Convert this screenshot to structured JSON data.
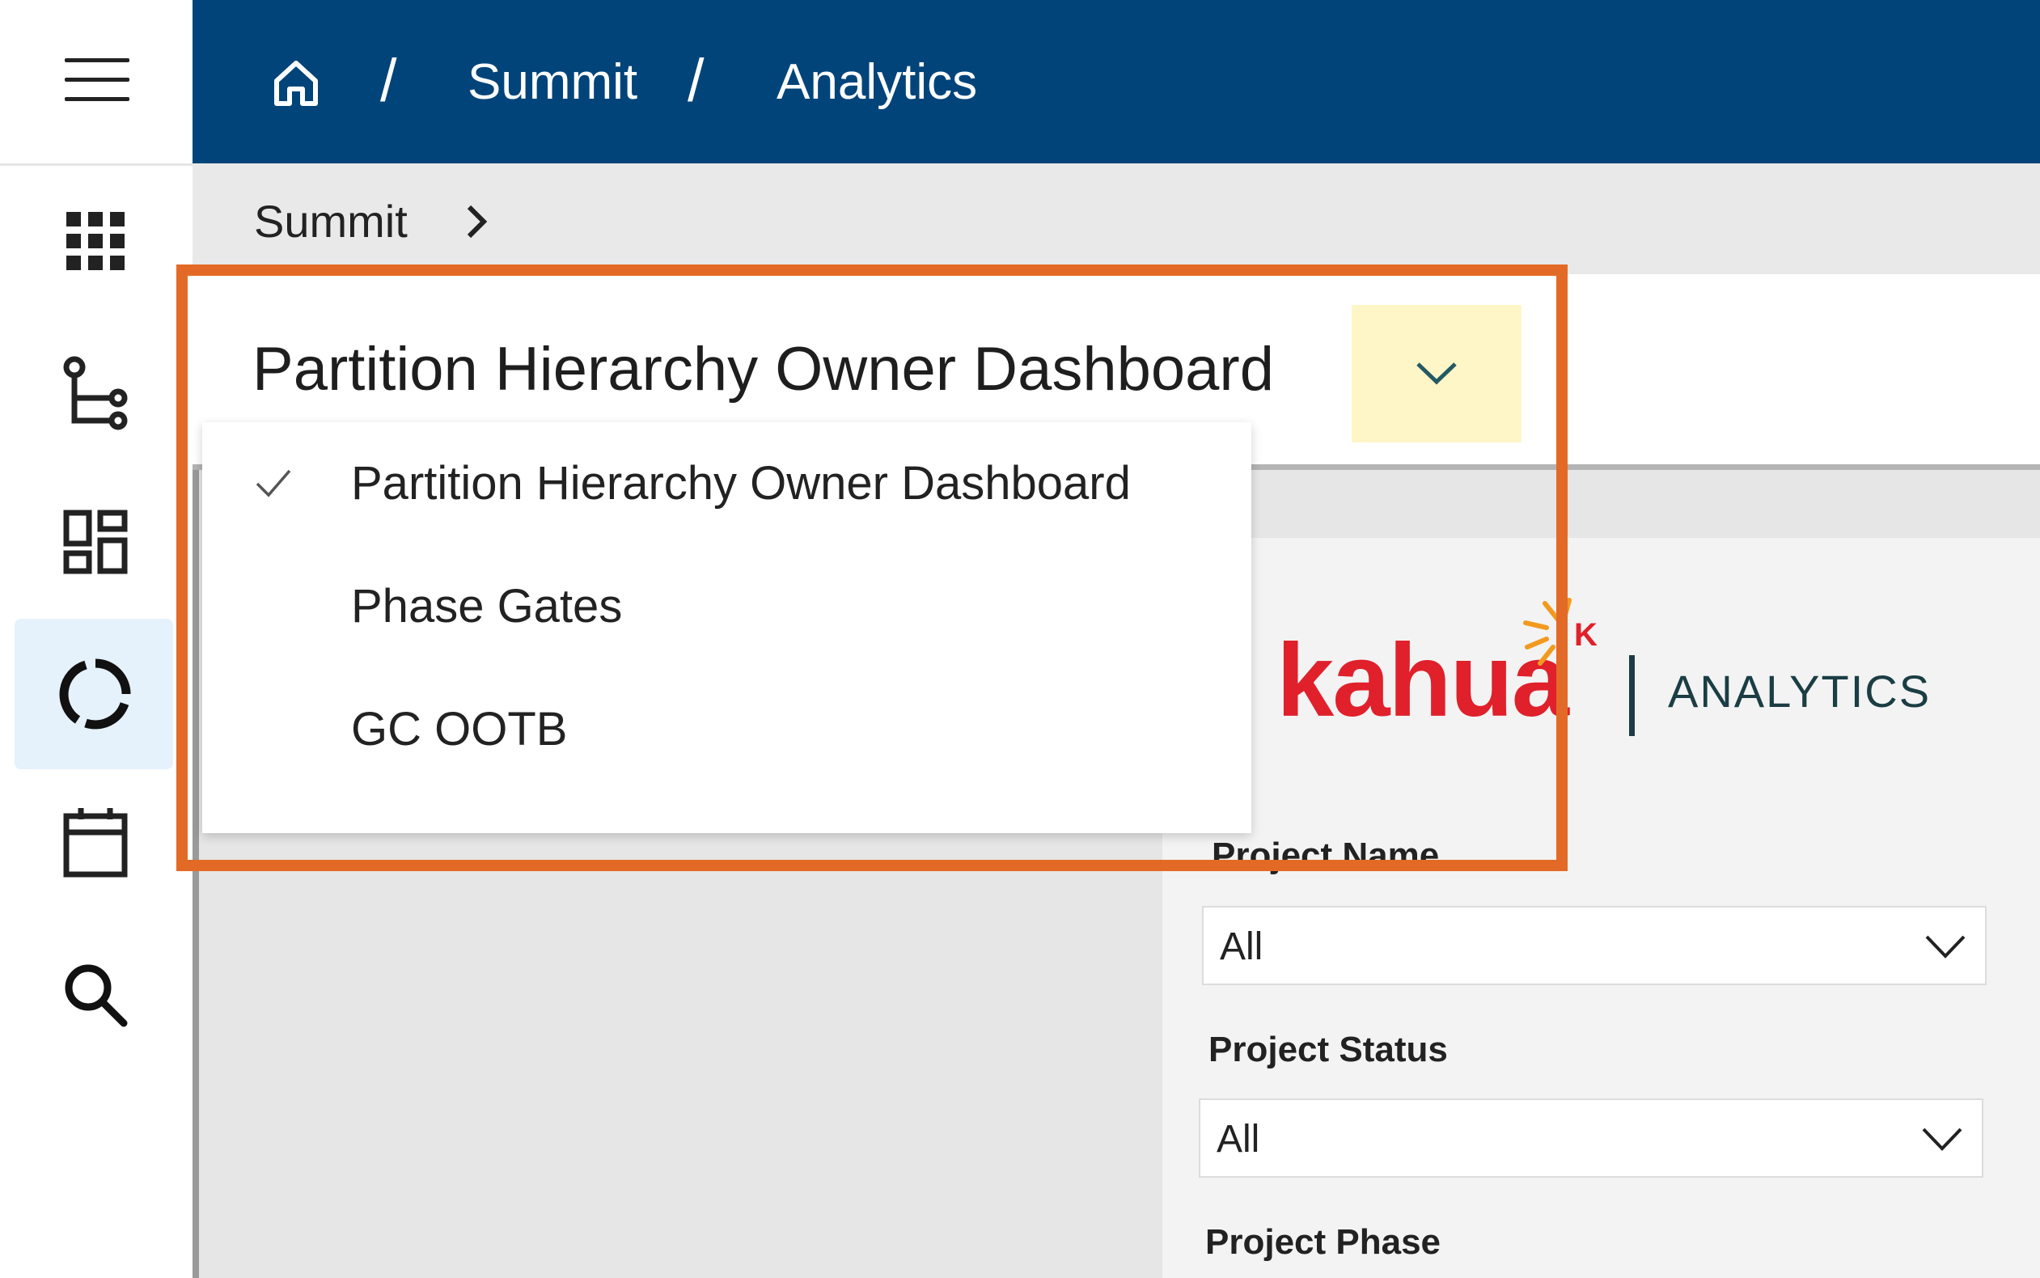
{
  "topbar": {
    "home_icon": "home-icon",
    "sep1": "/",
    "crumb1": "Summit",
    "sep2": "/",
    "crumb2": "Analytics",
    "background": "#01447a"
  },
  "rail": {
    "menu_icon": "hamburger-menu-icon",
    "items": [
      {
        "icon": "apps-grid-icon"
      },
      {
        "icon": "hierarchy-tree-icon"
      },
      {
        "icon": "dashboard-icon"
      },
      {
        "icon": "analytics-ring-icon",
        "active": true
      },
      {
        "icon": "calendar-icon"
      },
      {
        "icon": "search-icon"
      }
    ],
    "active_color": "#e5f1fb"
  },
  "subcrumb": {
    "label": "Summit",
    "chevron": "chevron-right-icon"
  },
  "title": {
    "text": "Partition Hierarchy Owner Dashboard",
    "toggle_icon": "chevron-down-icon",
    "toggle_color": "#fff6c8"
  },
  "dropdown": {
    "items": [
      {
        "label": "Partition Hierarchy Owner Dashboard",
        "selected": true
      },
      {
        "label": "Phase Gates",
        "selected": false
      },
      {
        "label": "GC OOTB",
        "selected": false
      }
    ],
    "check_icon": "checkmark-icon"
  },
  "report": {
    "logo_word": "kahua",
    "logo_mark": "K",
    "logo_product": "ANALYTICS",
    "brand_red": "#e0202b",
    "brand_orange": "#f29a1f",
    "filters": [
      {
        "label": "Project Name",
        "value": "All"
      },
      {
        "label": "Project Status",
        "value": "All"
      },
      {
        "label": "Project Phase",
        "value": ""
      }
    ]
  },
  "highlight_color": "#e36a26"
}
